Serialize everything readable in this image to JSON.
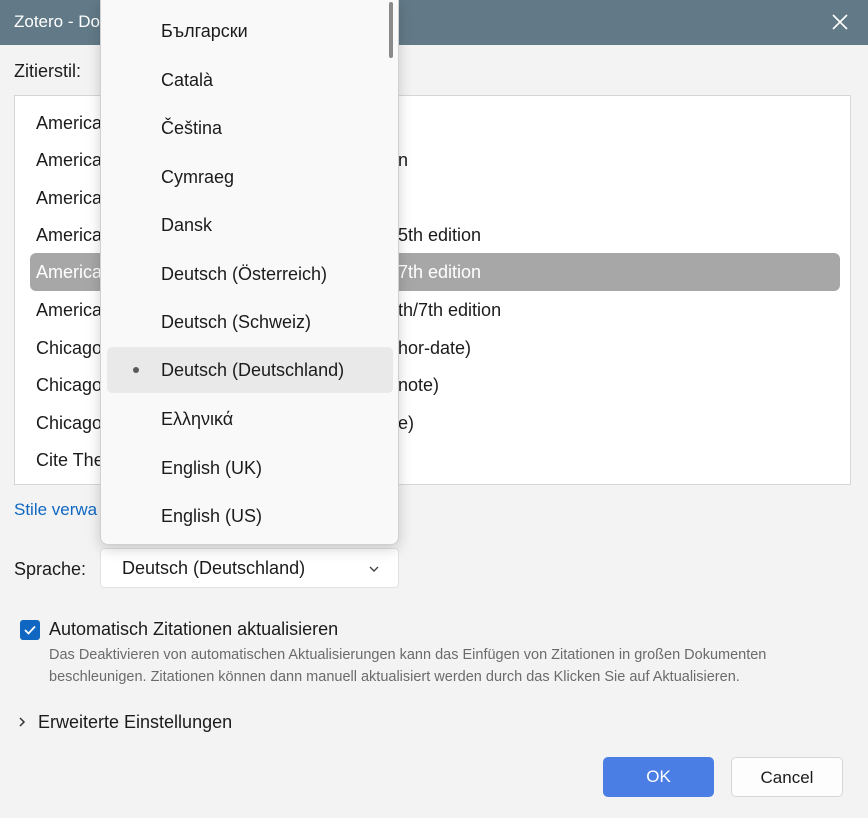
{
  "window": {
    "title": "Zotero - Do"
  },
  "citation_style": {
    "label": "Zitierstil:",
    "rows": [
      {
        "left": "America",
        "right": ""
      },
      {
        "left": "America",
        "right": "n"
      },
      {
        "left": "America",
        "right": ""
      },
      {
        "left": "America",
        "right": "5th edition"
      },
      {
        "left": "America",
        "right": "7th edition",
        "selected": true
      },
      {
        "left": "America",
        "right": "th/7th edition"
      },
      {
        "left": "Chicago",
        "right": "hor-date)"
      },
      {
        "left": "Chicago",
        "right": "note)"
      },
      {
        "left": "Chicago",
        "right": "e)"
      },
      {
        "left": "Cite The",
        "right": ""
      }
    ]
  },
  "manage_styles_link": "Stile verwa",
  "language": {
    "label": "Sprache:",
    "selected": "Deutsch (Deutschland)",
    "options": [
      "Български",
      "Català",
      "Čeština",
      "Cymraeg",
      "Dansk",
      "Deutsch (Österreich)",
      "Deutsch (Schweiz)",
      "Deutsch (Deutschland)",
      "Ελληνικά",
      "English (UK)",
      "English (US)"
    ]
  },
  "auto_update": {
    "checked": true,
    "label": "Automatisch Zitationen aktualisieren",
    "description": "Das Deaktivieren von automatischen Aktualisierungen kann das Einfügen von Zitationen in großen Dokumenten beschleunigen. Zitationen können dann manuell aktualisiert werden durch das Klicken Sie auf Aktualisieren."
  },
  "advanced_label": "Erweiterte Einstellungen",
  "buttons": {
    "ok": "OK",
    "cancel": "Cancel"
  },
  "colors": {
    "titlebar": "#627a87",
    "accent": "#4a7ee5",
    "link": "#0f67c2",
    "selection": "#a7a7a7"
  },
  "icons": {
    "close": "close-icon",
    "chevron": "chevron-down-icon",
    "expander": "chevron-right-icon",
    "check": "checkmark-icon",
    "bullet": "bullet-icon"
  }
}
